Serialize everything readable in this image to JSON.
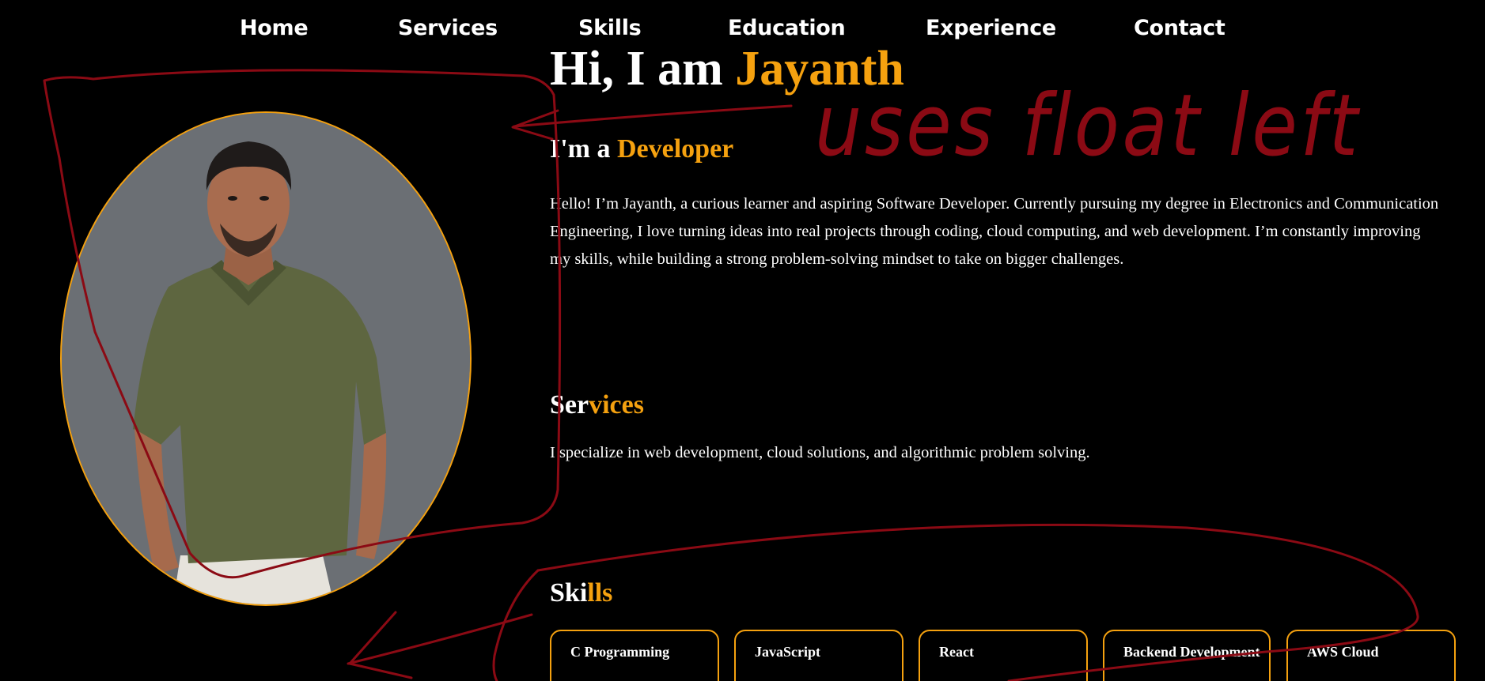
{
  "nav": {
    "items": [
      {
        "label": "Home"
      },
      {
        "label": "Services"
      },
      {
        "label": "Skills"
      },
      {
        "label": "Education"
      },
      {
        "label": "Experience"
      },
      {
        "label": "Contact"
      }
    ]
  },
  "hero": {
    "greeting": "Hi, I am ",
    "name": "Jayanth",
    "role_prefix": "I'm a ",
    "role": "Developer",
    "intro": "Hello! I’m Jayanth, a curious learner and aspiring Software Developer. Currently pursuing my degree in Electronics and Communication Engineering, I love turning ideas into real projects through coding, cloud computing, and web development. I’m constantly improving my skills, while building a strong problem-solving mindset to take on bigger challenges."
  },
  "services": {
    "heading_a": "Ser",
    "heading_b": "vices",
    "text": "I specialize in web development, cloud solutions, and algorithmic problem solving."
  },
  "skills": {
    "heading_a": "Ski",
    "heading_b": "lls",
    "cards": [
      {
        "label": "C Programming"
      },
      {
        "label": "JavaScript"
      },
      {
        "label": "React"
      },
      {
        "label": "Backend Development"
      },
      {
        "label": "AWS Cloud"
      }
    ]
  },
  "annotation": {
    "text": "uses float left"
  },
  "colors": {
    "accent": "#f5a10f",
    "background": "#000000",
    "text": "#ffffff",
    "annotation_ink": "#8b0a14"
  }
}
